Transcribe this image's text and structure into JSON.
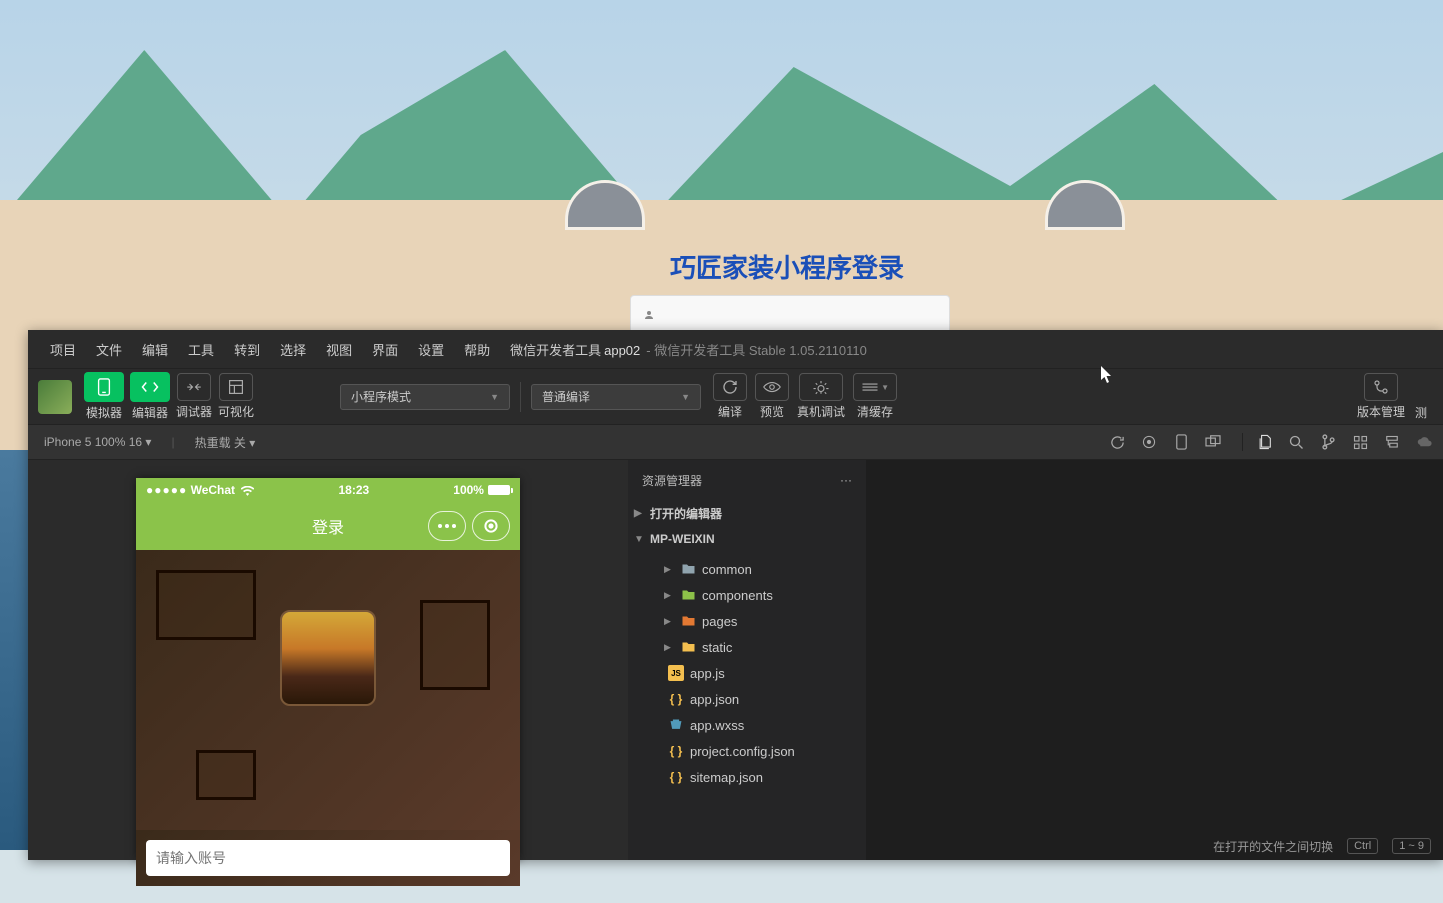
{
  "web_overlay": {
    "title": "巧匠家装小程序登录"
  },
  "ide": {
    "menubar": [
      "项目",
      "文件",
      "编辑",
      "工具",
      "转到",
      "选择",
      "视图",
      "界面",
      "设置",
      "帮助",
      "微信开发者工具"
    ],
    "title": {
      "project": "app02",
      "suffix": "- 微信开发者工具 Stable 1.05.2110110"
    },
    "toolbar": {
      "simulator": "模拟器",
      "editor": "编辑器",
      "debugger": "调试器",
      "visualize": "可视化",
      "mode_dropdown": "小程序模式",
      "compile_dropdown": "普通编译",
      "compile": "编译",
      "preview": "预览",
      "real_debug": "真机调试",
      "clear_cache": "清缓存",
      "version_mgmt": "版本管理",
      "test": "测"
    },
    "sub_toolbar": {
      "device": "iPhone 5 100% 16 ▾",
      "hot_reload": "热重载 关 ▾"
    },
    "explorer": {
      "title": "资源管理器",
      "open_editors": "打开的编辑器",
      "root": "MP-WEIXIN",
      "folders": [
        {
          "name": "common",
          "icon": "folder"
        },
        {
          "name": "components",
          "icon": "folder-green"
        },
        {
          "name": "pages",
          "icon": "folder-orange"
        },
        {
          "name": "static",
          "icon": "folder-yellow"
        }
      ],
      "files": [
        {
          "name": "app.js",
          "icon": "js"
        },
        {
          "name": "app.json",
          "icon": "json"
        },
        {
          "name": "app.wxss",
          "icon": "wxss"
        },
        {
          "name": "project.config.json",
          "icon": "json"
        },
        {
          "name": "sitemap.json",
          "icon": "json"
        }
      ]
    },
    "statusbar": {
      "hint": "在打开的文件之间切换",
      "kbd1": "Ctrl",
      "kbd2": "1 ~ 9"
    }
  },
  "phone": {
    "carrier": "WeChat",
    "time": "18:23",
    "battery": "100%",
    "nav_title": "登录",
    "input_placeholder": "请输入账号"
  }
}
